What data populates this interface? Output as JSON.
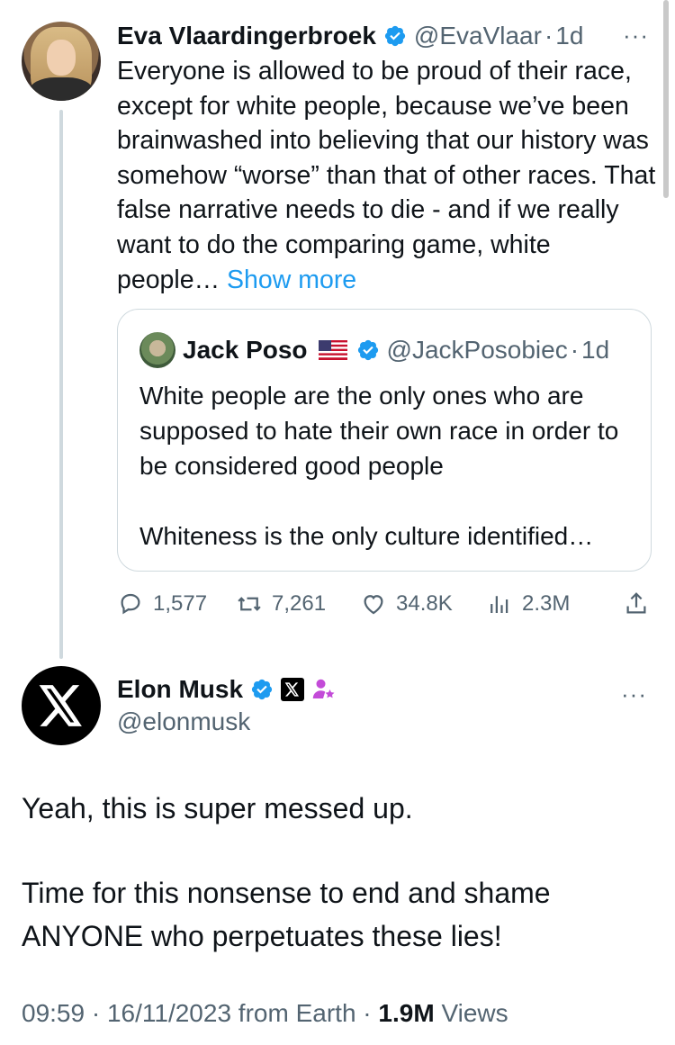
{
  "parent_tweet": {
    "author_name": "Eva Vlaardingerbroek",
    "handle": "@EvaVlaar",
    "separator": "·",
    "time": "1d",
    "more_icon": "more-dots-icon",
    "text": "Everyone is allowed to be proud of their race, except for white people, because we’ve been brainwashed into believing that our history was somehow “worse” than that of other races. That false narrative needs to die - and if we really want to do the comparing game, white people…",
    "show_more": "Show more",
    "quote": {
      "author_name": "Jack Poso",
      "handle": "@JackPosobiec",
      "separator": "·",
      "time": "1d",
      "text_line1": "White people are the only ones who are supposed to hate their own race in order to be considered good people",
      "text_line2": "Whiteness is the only culture identified…"
    },
    "metrics": {
      "replies": "1,577",
      "reposts": "7,261",
      "likes": "34.8K",
      "views": "2.3M"
    }
  },
  "reply_tweet": {
    "author_name": "Elon Musk",
    "handle": "@elonmusk",
    "more_icon": "more-dots-icon",
    "text_para1": "Yeah, this is super messed up.",
    "text_para2": "Time for this nonsense to end and shame ANYONE who perpetuates these lies!",
    "footer": {
      "time": "09:59",
      "sep1": "·",
      "date": "16/11/2023 from Earth",
      "sep2": "·",
      "views_count": "1.9M",
      "views_label": "Views"
    }
  },
  "colors": {
    "accent": "#1d9bf0",
    "text": "#0f1419",
    "muted": "#536471",
    "border": "#cfd9de"
  }
}
